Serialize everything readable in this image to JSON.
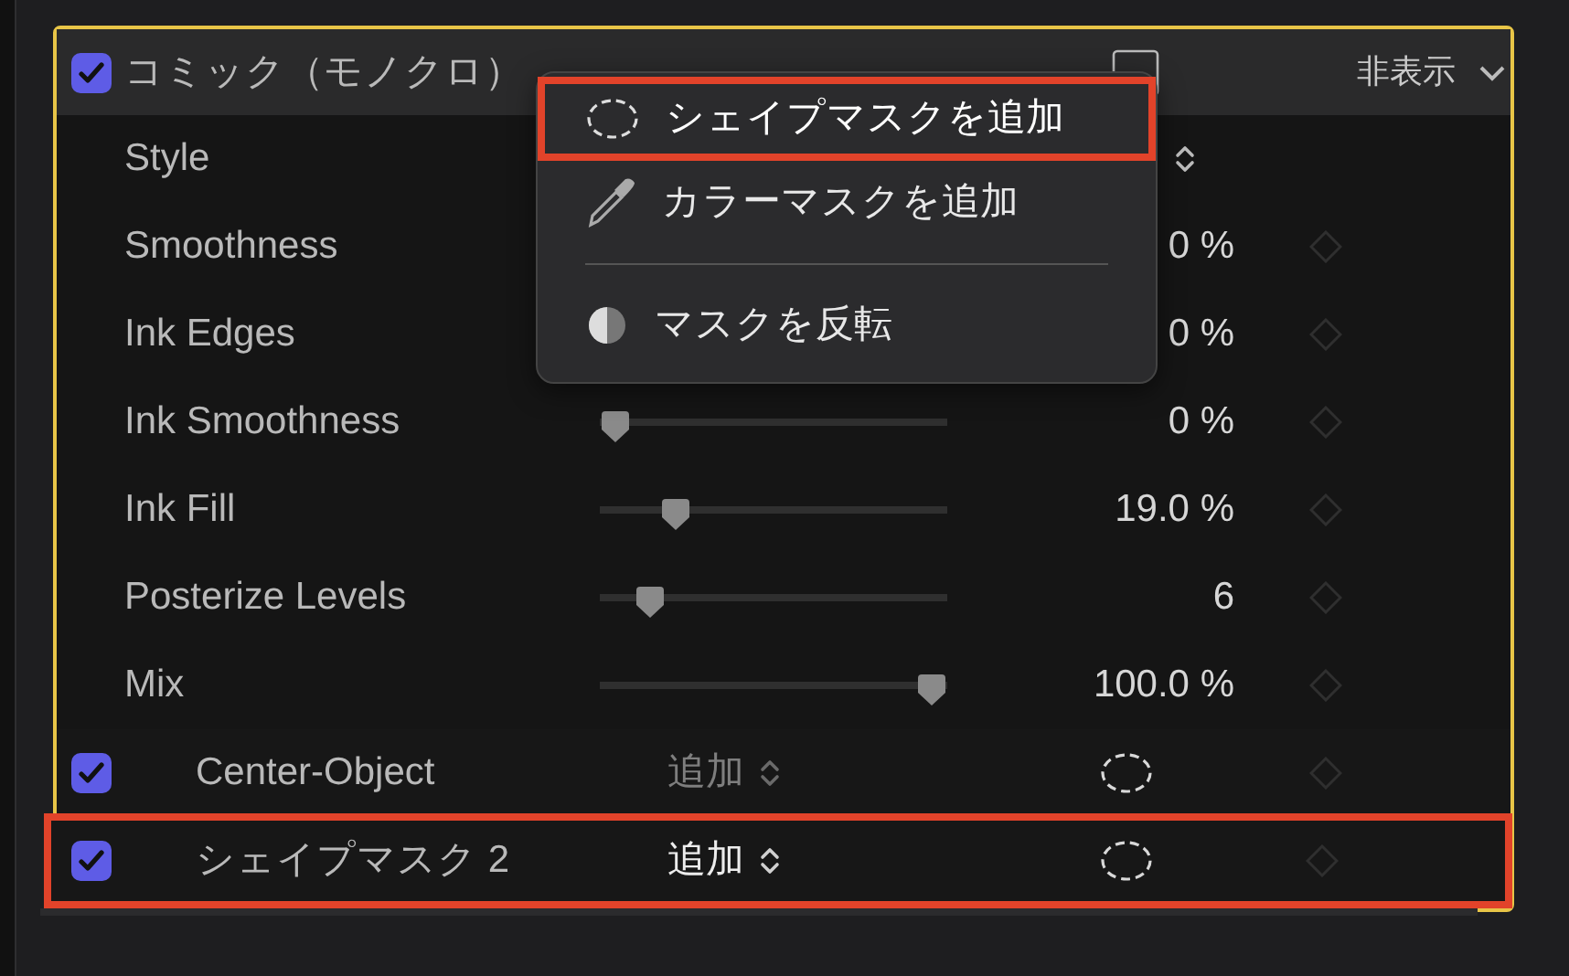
{
  "effect": {
    "name": "コミック（モノクロ）",
    "enabled": true,
    "visibility": "非表示"
  },
  "params": [
    {
      "kind": "popup",
      "label": "Style"
    },
    {
      "kind": "slider",
      "label": "Smoothness",
      "value": "0 %"
    },
    {
      "kind": "slider",
      "label": "Ink Edges",
      "value": "0 %"
    },
    {
      "kind": "slider",
      "label": "Ink Smoothness",
      "value": "0 %",
      "level": 0
    },
    {
      "kind": "slider",
      "label": "Ink Fill",
      "value": "19.0 %",
      "level": 0.19
    },
    {
      "kind": "slider",
      "label": "Posterize Levels",
      "value": "6",
      "level": 0.11
    },
    {
      "kind": "slider",
      "label": "Mix",
      "value": "100.0 %",
      "level": 1
    }
  ],
  "masks": [
    {
      "name": "Center-Object",
      "enabled": true,
      "mode": "追加",
      "selected": false,
      "highlighted": false
    },
    {
      "name": "シェイプマスク 2",
      "enabled": true,
      "mode": "追加",
      "selected": true,
      "highlighted": true
    }
  ],
  "menu": [
    {
      "kind": "shape",
      "label": "シェイプマスクを追加",
      "highlighted": true
    },
    {
      "kind": "color",
      "label": "カラーマスクを追加",
      "highlighted": false
    },
    {
      "kind": "separator"
    },
    {
      "kind": "invert",
      "label": "マスクを反転",
      "highlighted": false
    }
  ]
}
